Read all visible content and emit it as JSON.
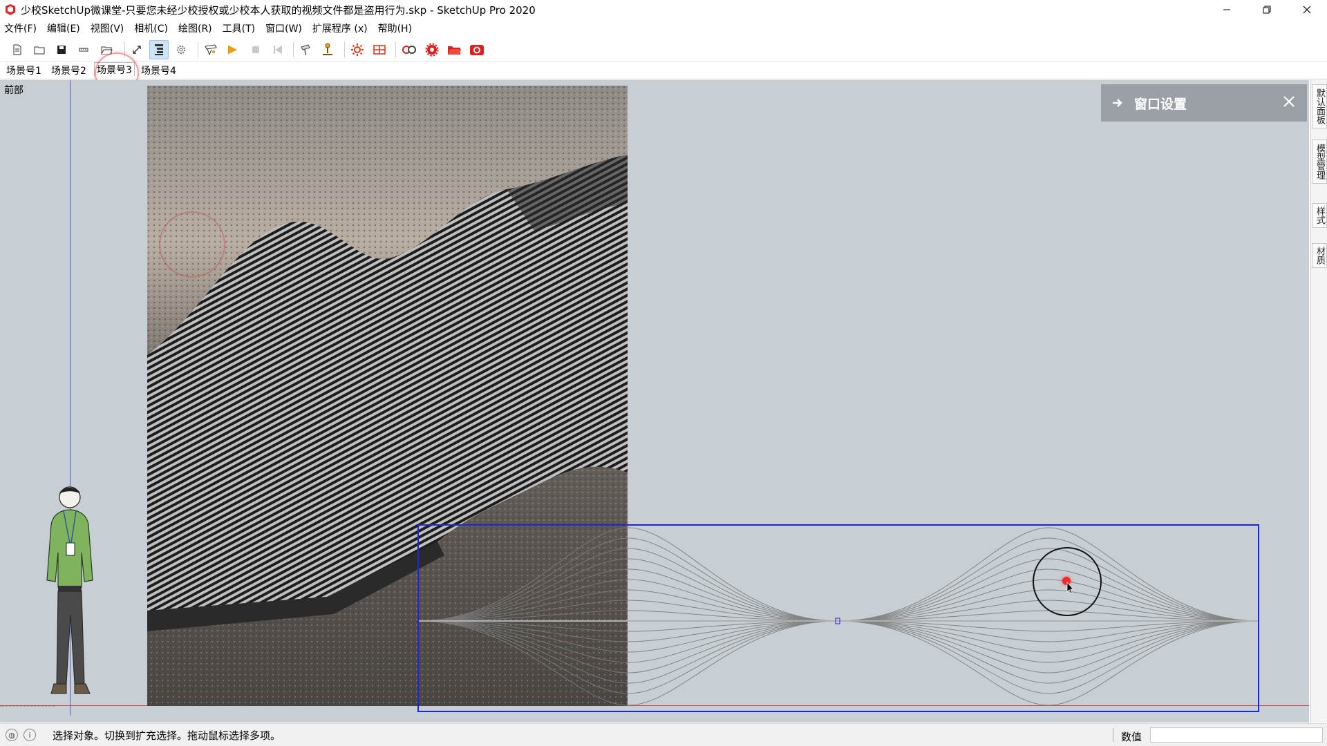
{
  "window": {
    "title": "少校SketchUp微课堂-只要您未经少校授权或少校本人获取的视频文件都是盗用行为.skp - SketchUp Pro 2020"
  },
  "menu": {
    "items": [
      "文件(F)",
      "编辑(E)",
      "视图(V)",
      "相机(C)",
      "绘图(R)",
      "工具(T)",
      "窗口(W)",
      "扩展程序 (x)",
      "帮助(H)"
    ]
  },
  "toolbar": {
    "icons": [
      "new-file-icon",
      "open-folder-icon",
      "save-icon",
      "tape-icon",
      "open-folder-icon",
      "zoom-extents-icon",
      "outliner-icon",
      "settings-gear-icon",
      "scene-icon",
      "play-icon",
      "stop-icon",
      "rewind-icon",
      "pushpin-icon",
      "person-stand-icon",
      "shadow-sun-icon",
      "section-plane-icon",
      "camera-tool-icon",
      "render-settings-icon",
      "red-folder-icon",
      "red-camera-icon"
    ]
  },
  "scenes": {
    "tabs": [
      "场景号1",
      "场景号2",
      "场景号3",
      "场景号4"
    ],
    "active_index": 2
  },
  "viewport": {
    "view_label": "前部"
  },
  "window_panel": {
    "title": "窗口设置"
  },
  "tray": {
    "tabs": [
      "默认面板",
      "模型管理",
      "样式",
      "材质"
    ]
  },
  "status": {
    "message": "选择对象。切换到扩充选择。拖动鼠标选择多项。",
    "measure_label": "数值",
    "measure_value": ""
  },
  "colors": {
    "viewport_bg": "#c8cfd4",
    "selection": "#1c28d8",
    "axis_red": "#d24a4a",
    "axis_blue": "#4b5fd0",
    "panel_bg": "#9aa0a6"
  }
}
